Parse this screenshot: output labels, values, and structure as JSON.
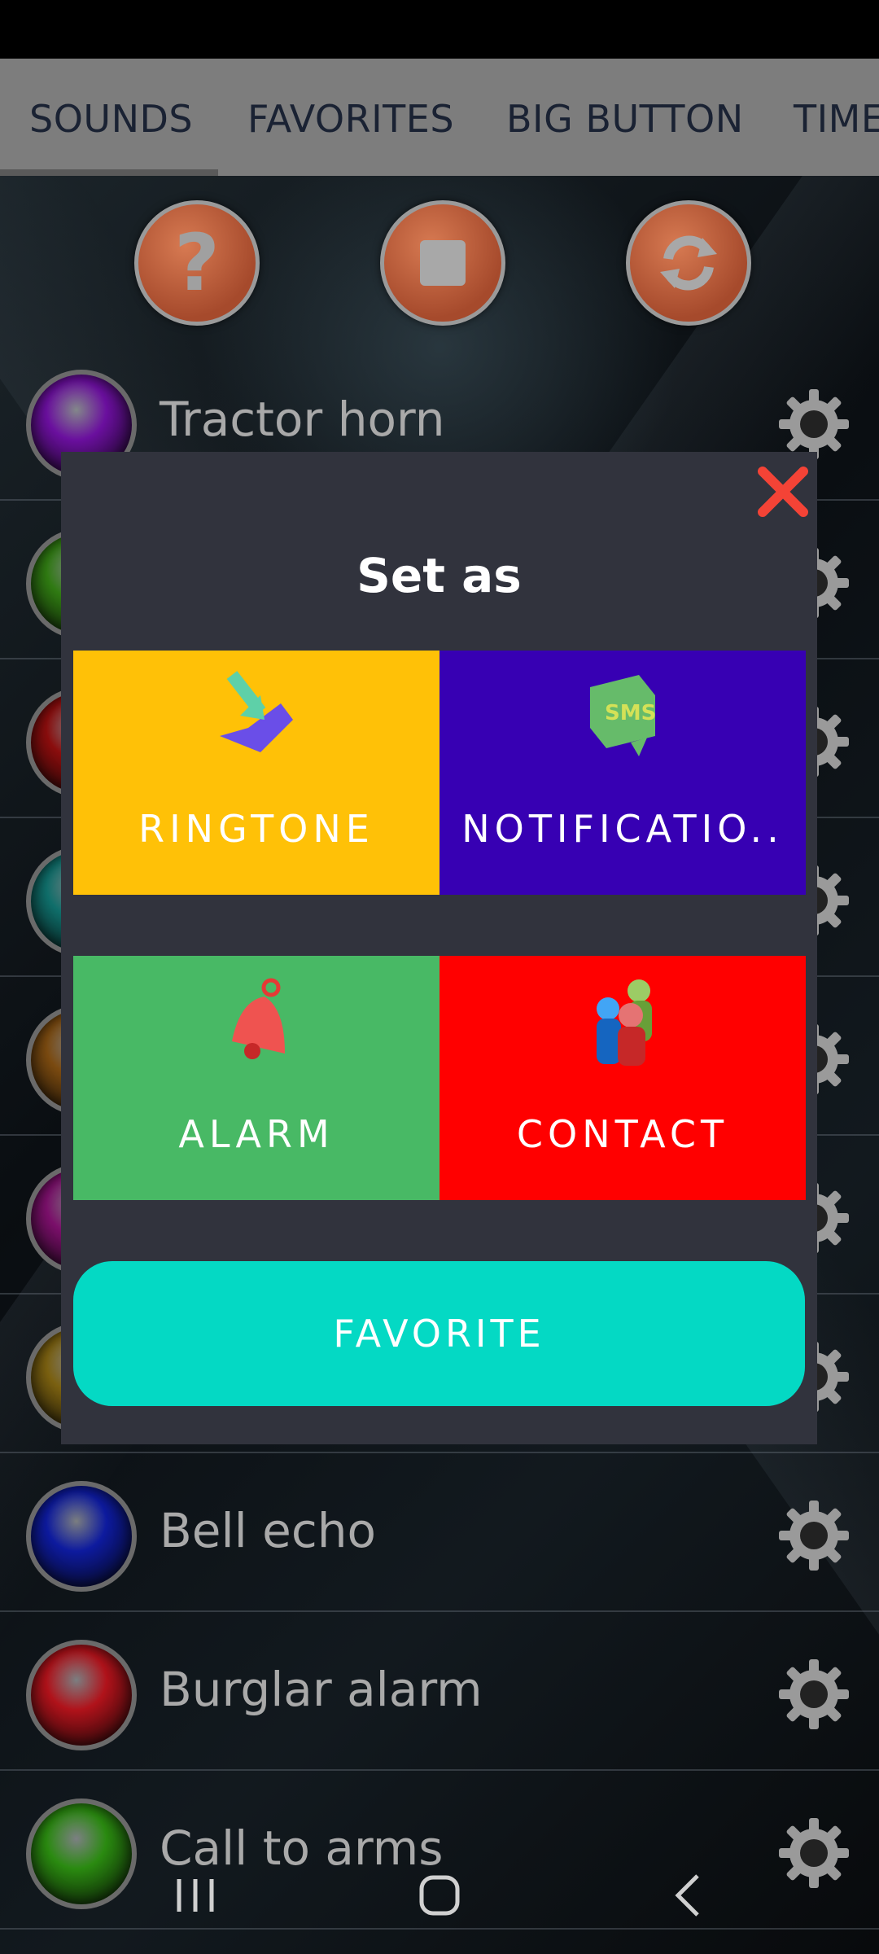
{
  "tabs": [
    {
      "label": "SOUNDS"
    },
    {
      "label": "FAVORITES"
    },
    {
      "label": "BIG BUTTON"
    },
    {
      "label": "TIME"
    }
  ],
  "controls": {
    "help_icon": "question-icon",
    "stop_icon": "stop-icon",
    "repeat_icon": "repeat-icon"
  },
  "sounds": [
    {
      "label": "Tractor horn",
      "color": "#6a0f9e"
    },
    {
      "label": "",
      "color": "#2f7a12"
    },
    {
      "label": "",
      "color": "#8a0d0d"
    },
    {
      "label": "",
      "color": "#0f6e6a"
    },
    {
      "label": "",
      "color": "#7a4a10"
    },
    {
      "label": "",
      "color": "#7a0f6a"
    },
    {
      "label": "",
      "color": "#7a6010"
    },
    {
      "label": "Bell echo",
      "color": "#0d1a9e"
    },
    {
      "label": "Burglar alarm",
      "color": "#b0121a"
    },
    {
      "label": "Call to arms",
      "color": "#2a8a10"
    }
  ],
  "dialog": {
    "title": "Set as",
    "ringtone_label": "RINGTONE",
    "notification_label": "NOTIFICATIO..",
    "alarm_label": "ALARM",
    "contact_label": "CONTACT",
    "favorite_label": "FAVORITE",
    "colors": {
      "ringtone": "#ffc107",
      "notification": "#3700b3",
      "alarm": "#48b965",
      "contact": "#ff0000",
      "favorite": "#04d9c4",
      "close": "#f44336"
    }
  }
}
